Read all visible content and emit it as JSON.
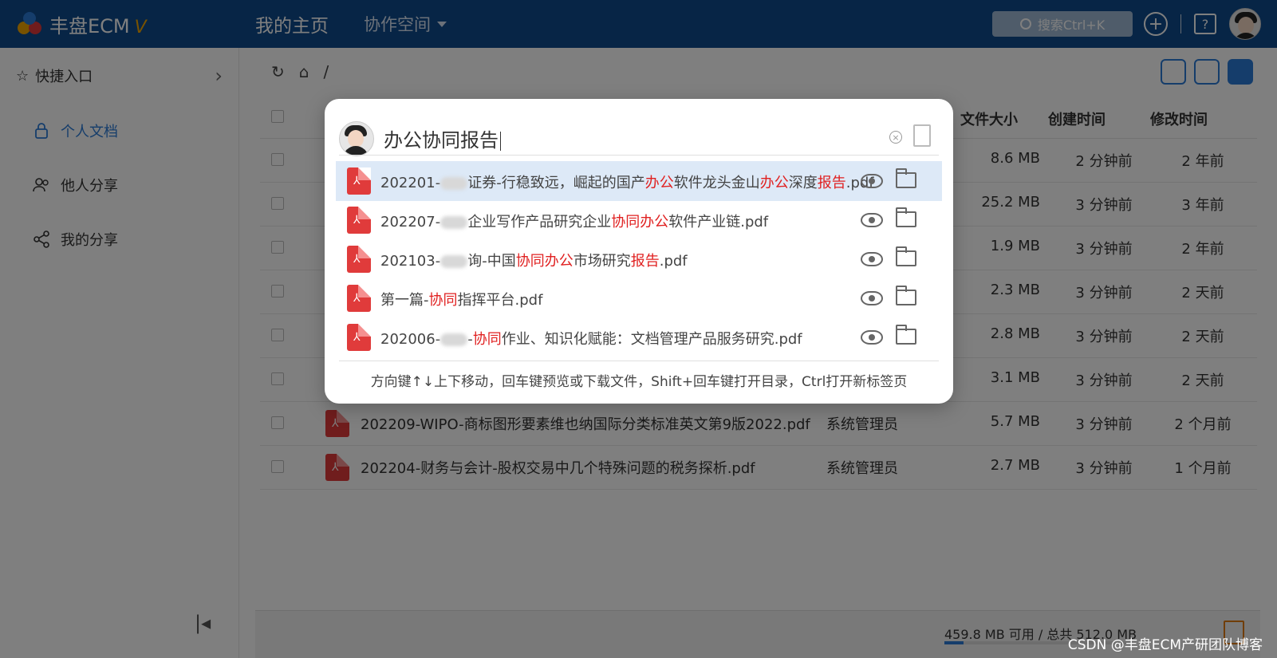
{
  "header": {
    "logo_text": "丰盘ECM",
    "logo_v": "V",
    "nav_home": "我的主页",
    "nav_collab": "协作空间",
    "search_label": "搜索Ctrl+K",
    "add_icon": "plus-circle-icon",
    "help_icon": "question-icon"
  },
  "sidebar": {
    "quick_entry": "快捷入口",
    "items": [
      {
        "label": "个人文档",
        "icon": "lock-icon"
      },
      {
        "label": "他人分享",
        "icon": "users-icon"
      },
      {
        "label": "我的分享",
        "icon": "share-icon"
      }
    ]
  },
  "main": {
    "breadcrumb_root": "/",
    "columns": {
      "size": "文件大小",
      "created": "创建时间",
      "modified": "修改时间"
    },
    "rows": [
      {
        "name": "",
        "owner": "",
        "size": "8.6 MB",
        "created": "2 分钟前",
        "modified": "2 年前"
      },
      {
        "name": "",
        "owner": "",
        "size": "25.2 MB",
        "created": "3 分钟前",
        "modified": "3 年前"
      },
      {
        "name": "",
        "owner": "",
        "size": "1.9 MB",
        "created": "3 分钟前",
        "modified": "2 年前"
      },
      {
        "name": "",
        "owner": "",
        "size": "2.3 MB",
        "created": "3 分钟前",
        "modified": "2 天前"
      },
      {
        "name": "",
        "owner": "",
        "size": "2.8 MB",
        "created": "3 分钟前",
        "modified": "2 天前"
      },
      {
        "name": "",
        "owner": "",
        "size": "3.1 MB",
        "created": "3 分钟前",
        "modified": "2 天前"
      },
      {
        "name": "202209-WIPO-商标图形要素维也纳国际分类标准英文第9版2022.pdf",
        "owner": "系统管理员",
        "size": "5.7 MB",
        "created": "3 分钟前",
        "modified": "2 个月前"
      },
      {
        "name": "202204-财务与会计-股权交易中几个特殊问题的税务探析.pdf",
        "owner": "系统管理员",
        "size": "2.7 MB",
        "created": "3 分钟前",
        "modified": "1 个月前"
      }
    ],
    "quota": "459.8 MB 可用 / 总共 512.0 MB",
    "quota_used_fraction": 0.1
  },
  "search_modal": {
    "query": "办公协同报告",
    "results": [
      {
        "parts": [
          "202201-",
          "",
          "证券-行稳致远，崛起的国产",
          "办公",
          "软件龙头金山",
          "办公",
          "深度",
          "报告",
          ".pdf"
        ],
        "hl": [
          false,
          "blur",
          false,
          true,
          false,
          true,
          false,
          true,
          false
        ]
      },
      {
        "parts": [
          "202207-",
          "",
          "企业写作产品研究企业",
          "协同办公",
          "软件产业链.pdf"
        ],
        "hl": [
          false,
          "blur",
          false,
          true,
          false
        ]
      },
      {
        "parts": [
          "202103-",
          "",
          "询-中国",
          "协同办公",
          "市场研究",
          "报告",
          ".pdf"
        ],
        "hl": [
          false,
          "blur",
          false,
          true,
          false,
          true,
          false
        ]
      },
      {
        "parts": [
          "第一篇-",
          "协同",
          "指挥平台.pdf"
        ],
        "hl": [
          false,
          true,
          false
        ]
      },
      {
        "parts": [
          "202006-",
          "",
          "-",
          "协同",
          "作业、知识化赋能：文档管理产品服务研究.pdf"
        ],
        "hl": [
          false,
          "blur",
          false,
          true,
          false
        ]
      }
    ],
    "hint": "方向键↑↓上下移动，回车键预览或下载文件，Shift+回车键打开目录，Ctrl打开新标签页"
  },
  "watermark": "CSDN @丰盘ECM产研团队博客",
  "colors": {
    "header_bg": "#0e4a8c",
    "accent": "#2a7ad6",
    "highlight": "#e02020",
    "pdf_red": "#e03b3b"
  }
}
